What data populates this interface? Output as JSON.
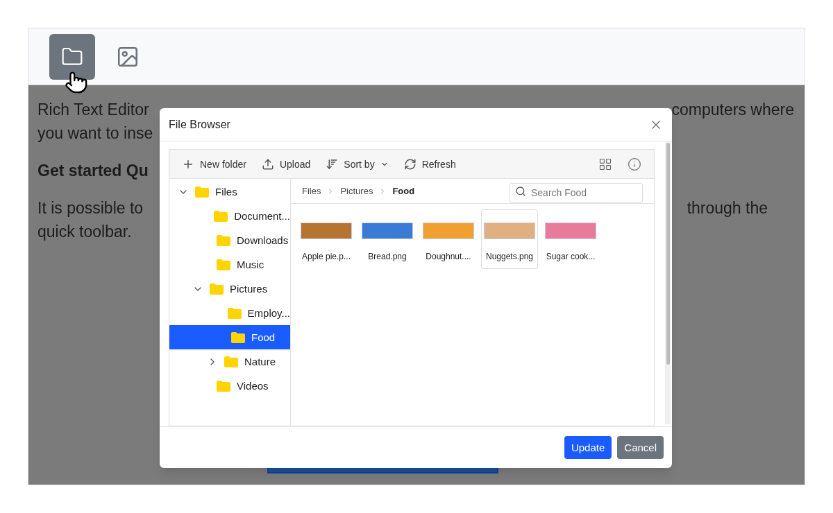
{
  "toolbar": {
    "buttons": [
      {
        "kind": "folder",
        "selected": true
      },
      {
        "kind": "image",
        "selected": false
      }
    ]
  },
  "editor": {
    "line_1": "Rich Text Editor",
    "line_1_end": "computers where",
    "line_2": "you want to inse",
    "heading": "Get started Qu",
    "paragraph_left": "It is possible to",
    "paragraph_right": "through the",
    "paragraph_line_2": "quick toolbar."
  },
  "dialog": {
    "title": "File Browser",
    "file_manager": {
      "toolbar": [
        {
          "kind": "new",
          "label": "New folder"
        },
        {
          "kind": "upload",
          "label": "Upload"
        },
        {
          "kind": "sort",
          "label": "Sort by"
        },
        {
          "kind": "refresh",
          "label": "Refresh"
        }
      ],
      "tree": [
        {
          "label": "Files",
          "has_children": true,
          "expanded": true,
          "selected": false,
          "children": [
            {
              "label": "Document...",
              "has_children": false,
              "expanded": false,
              "selected": false
            },
            {
              "label": "Downloads",
              "has_children": false,
              "expanded": false,
              "selected": false
            },
            {
              "label": "Music",
              "has_children": false,
              "expanded": false,
              "selected": false
            },
            {
              "label": "Pictures",
              "has_children": true,
              "expanded": true,
              "selected": false,
              "children": [
                {
                  "label": "Employ...",
                  "has_children": false,
                  "expanded": false,
                  "selected": false
                },
                {
                  "label": "Food",
                  "has_children": false,
                  "expanded": false,
                  "selected": true
                },
                {
                  "label": "Nature",
                  "has_children": true,
                  "expanded": false,
                  "selected": false
                }
              ]
            },
            {
              "label": "Videos",
              "has_children": false,
              "expanded": false,
              "selected": false
            }
          ]
        }
      ],
      "breadcrumb": [
        "Files",
        "Pictures",
        "Food"
      ],
      "search": {
        "placeholder": "Search Food"
      },
      "files": [
        {
          "name": "Apple pie.p...",
          "selected": false
        },
        {
          "name": "Bread.png",
          "selected": false
        },
        {
          "name": "Doughnut....",
          "selected": false
        },
        {
          "name": "Nuggets.png",
          "selected": true
        },
        {
          "name": "Sugar cook...",
          "selected": false
        }
      ]
    },
    "buttons": [
      {
        "kind": "primary",
        "label": "Update"
      },
      {
        "kind": "secondary",
        "label": "Cancel"
      }
    ]
  }
}
